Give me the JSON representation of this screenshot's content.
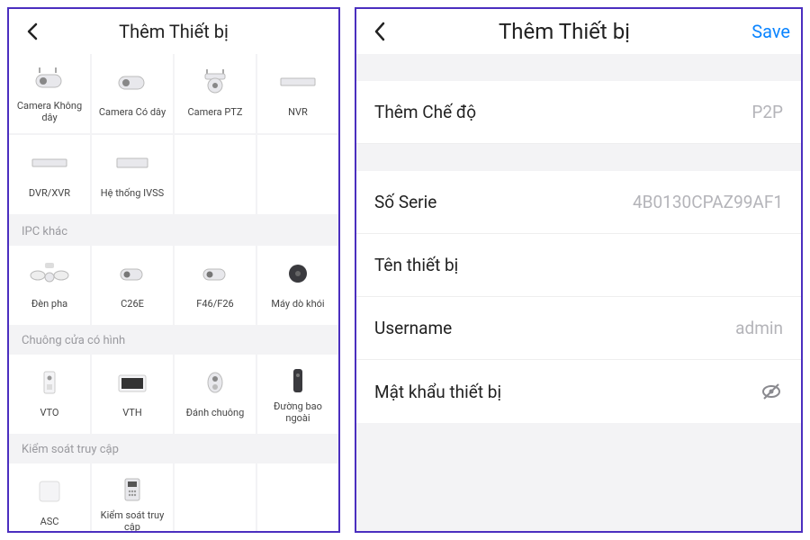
{
  "left": {
    "title": "Thêm Thiết bị",
    "section1": [
      {
        "id": "cam-wireless",
        "label": "Camera Không dây"
      },
      {
        "id": "cam-wired",
        "label": "Camera Có dây"
      },
      {
        "id": "cam-ptz",
        "label": "Camera PTZ"
      },
      {
        "id": "nvr",
        "label": "NVR"
      },
      {
        "id": "dvr-xvr",
        "label": "DVR/XVR"
      },
      {
        "id": "ivss",
        "label": "Hệ thống IVSS"
      }
    ],
    "sections": [
      {
        "header": "IPC khác",
        "items": [
          {
            "id": "floodlight",
            "label": "Đèn pha"
          },
          {
            "id": "c26e",
            "label": "C26E"
          },
          {
            "id": "f46-f26",
            "label": "F46/F26"
          },
          {
            "id": "smoke",
            "label": "Máy dò khói"
          }
        ]
      },
      {
        "header": "Chuông cửa có hình",
        "items": [
          {
            "id": "vto",
            "label": "VTO"
          },
          {
            "id": "vth",
            "label": "VTH"
          },
          {
            "id": "doorbell",
            "label": "Đánh chuông"
          },
          {
            "id": "outdoor",
            "label": "Đường bao ngoài"
          }
        ]
      },
      {
        "header": "Kiểm soát truy cập",
        "items": [
          {
            "id": "asc",
            "label": "ASC"
          },
          {
            "id": "access",
            "label": "Kiểm soát truy cập"
          }
        ]
      }
    ]
  },
  "right": {
    "title": "Thêm Thiết bị",
    "action": "Save",
    "rows": {
      "mode": {
        "label": "Thêm Chế độ",
        "value": "P2P"
      },
      "serial": {
        "label": "Số Serie",
        "value": "4B0130CPAZ99AF1"
      },
      "name": {
        "label": "Tên thiết bị",
        "value": ""
      },
      "user": {
        "label": "Username",
        "value": "admin"
      },
      "password": {
        "label": "Mật khẩu thiết bị",
        "value": ""
      }
    }
  },
  "icons": {
    "cam-wireless": "bullet-cam-wifi",
    "cam-wired": "bullet-cam",
    "cam-ptz": "ptz-cam",
    "nvr": "box-long",
    "dvr-xvr": "box-long",
    "ivss": "box-flat",
    "floodlight": "floodlight",
    "c26e": "bullet-cam-small",
    "f46-f26": "bullet-cam-small",
    "smoke": "disc",
    "vto": "door-panel",
    "vth": "tablet",
    "doorbell": "bell-round",
    "outdoor": "pillar",
    "asc": "square-panel",
    "access": "keypad"
  }
}
